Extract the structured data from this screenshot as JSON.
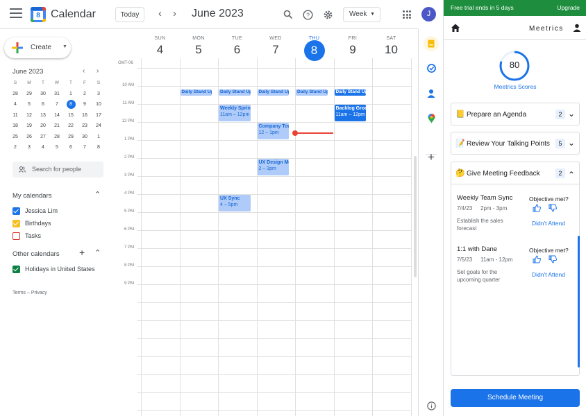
{
  "header": {
    "app_title": "Calendar",
    "logo_day": "8",
    "today_label": "Today",
    "prev": "‹",
    "next": "›",
    "month": "June 2023",
    "view": "Week",
    "avatar_initial": "J"
  },
  "sidebar": {
    "create_label": "Create",
    "mini": {
      "title": "June 2023",
      "weekdays": [
        "S",
        "M",
        "T",
        "W",
        "T",
        "F",
        "S"
      ],
      "weeks": [
        [
          "28",
          "29",
          "30",
          "31",
          "1",
          "2",
          "3"
        ],
        [
          "4",
          "5",
          "6",
          "7",
          "8",
          "9",
          "10"
        ],
        [
          "11",
          "12",
          "13",
          "14",
          "15",
          "16",
          "17"
        ],
        [
          "18",
          "19",
          "20",
          "21",
          "22",
          "23",
          "24"
        ],
        [
          "25",
          "26",
          "27",
          "28",
          "29",
          "30",
          "1"
        ],
        [
          "2",
          "3",
          "4",
          "5",
          "6",
          "7",
          "8"
        ]
      ],
      "selected": "8"
    },
    "search_people": "Search for people",
    "my_calendars_title": "My calendars",
    "my_calendars": [
      {
        "name": "Jessica Lim",
        "checked": true,
        "color": "#1a73e8"
      },
      {
        "name": "Birthdays",
        "checked": true,
        "color": "#f6bf26"
      },
      {
        "name": "Tasks",
        "checked": false,
        "color": "#d93025"
      }
    ],
    "other_calendars_title": "Other calendars",
    "other_calendars": [
      {
        "name": "Holidays in United States",
        "checked": true,
        "color": "#0b8043"
      }
    ],
    "terms": "Terms – Privacy"
  },
  "grid": {
    "timezone": "GMT-06",
    "days": [
      {
        "dow": "SUN",
        "num": "4"
      },
      {
        "dow": "MON",
        "num": "5"
      },
      {
        "dow": "TUE",
        "num": "6"
      },
      {
        "dow": "WED",
        "num": "7"
      },
      {
        "dow": "THU",
        "num": "8",
        "today": true
      },
      {
        "dow": "FRI",
        "num": "9"
      },
      {
        "dow": "SAT",
        "num": "10"
      }
    ],
    "times": [
      "10 AM",
      "11 AM",
      "12 PM",
      "1 PM",
      "2 PM",
      "3 PM",
      "4 PM",
      "5 PM",
      "6 PM",
      "7 PM",
      "8 PM",
      "9 PM"
    ],
    "events": {
      "standup": "Daily Stand Up",
      "weekly_sprint": {
        "title": "Weekly Sprint",
        "time": "11am – 12pm"
      },
      "company_town": {
        "title": "Company Town",
        "time": "12 – 1pm"
      },
      "ux_design": {
        "title": "UX Design Meeting",
        "time": "2 – 3pm"
      },
      "ux_sync": {
        "title": "UX Sync",
        "time": "4 – 5pm"
      },
      "backlog": {
        "title": "Backlog Grooming",
        "time": "11am – 12pm"
      }
    }
  },
  "panel": {
    "trial_text": "Free trial ends in 5 days",
    "upgrade": "Upgrade",
    "brand": "Meetrics",
    "score": 80,
    "score_label": "Meetrics Scores",
    "sections": [
      {
        "emoji": "📒",
        "title": "Prepare an Agenda",
        "count": "2"
      },
      {
        "emoji": "📝",
        "title": "Review Your Talking Points",
        "count": "5"
      },
      {
        "emoji": "🤔",
        "title": "Give Meeting Feedback",
        "count": "2"
      }
    ],
    "meetings": [
      {
        "title": "Weekly Team Sync",
        "date": "7/4/23",
        "time": "2pm - 3pm",
        "goal": "Establish the sales forecast",
        "objective": "Objective met?",
        "didnt": "Didn't Attend"
      },
      {
        "title": "1:1 with Dane",
        "date": "7/5/23",
        "time": "11am - 12pm",
        "goal": "Set goals for the upcoming quarter",
        "objective": "Objective met?",
        "didnt": "Didn't Attend"
      }
    ],
    "schedule": "Schedule Meeting"
  }
}
